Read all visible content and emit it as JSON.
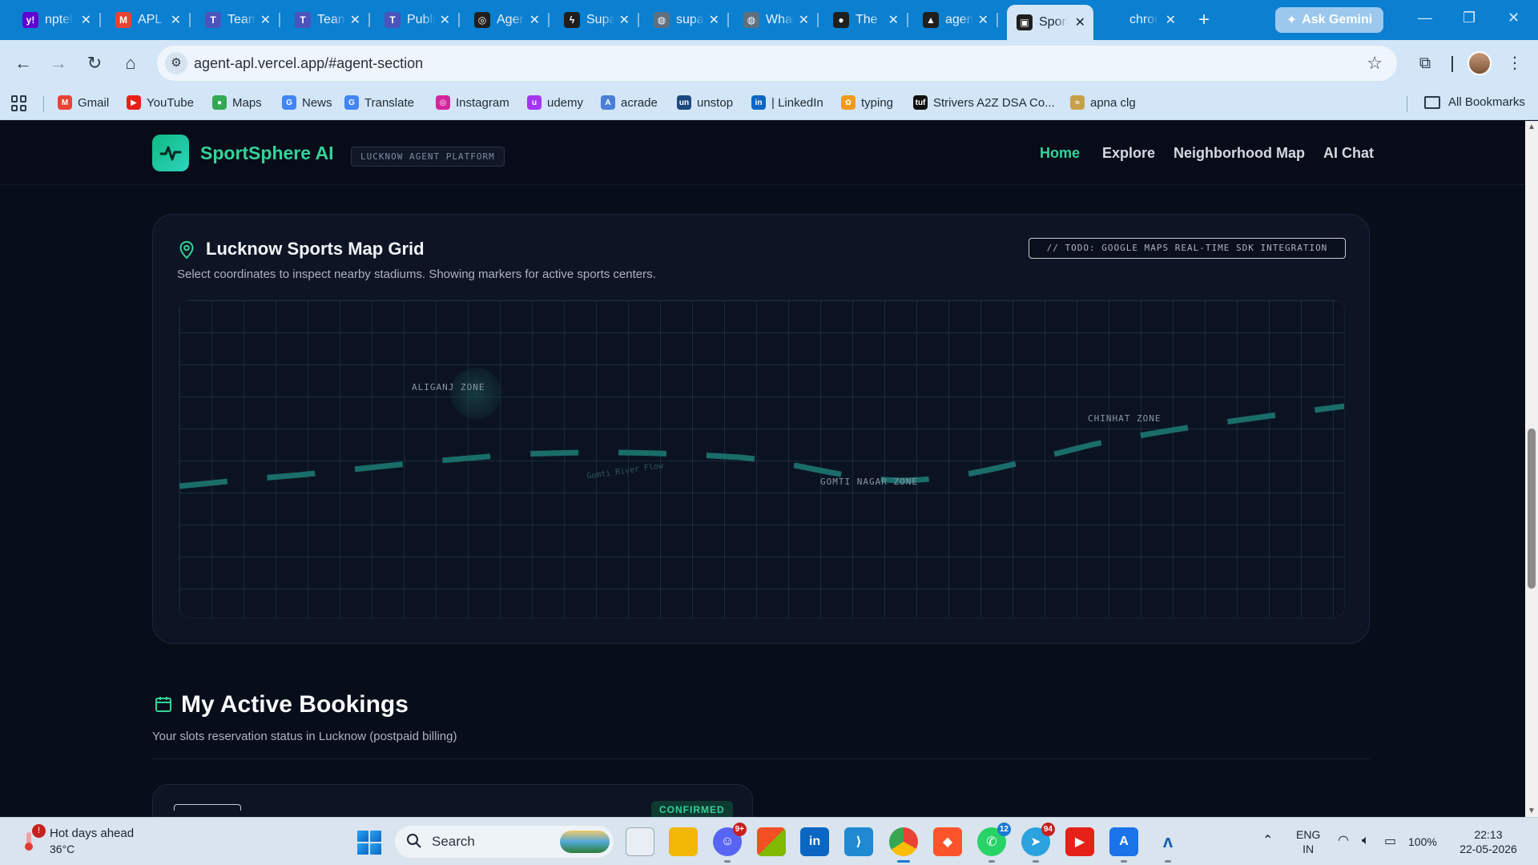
{
  "browser": {
    "tabs": [
      {
        "title": "nptel",
        "icon": "yahoo-icon",
        "color": "#6001d2",
        "glyph": "y!"
      },
      {
        "title": "APL",
        "icon": "gmail-icon",
        "color": "#ea4335",
        "glyph": "M"
      },
      {
        "title": "Teams",
        "icon": "teams-icon",
        "color": "#4b53bc",
        "glyph": "T"
      },
      {
        "title": "Teams",
        "icon": "teams-icon",
        "color": "#4b53bc",
        "glyph": "T"
      },
      {
        "title": "Public",
        "icon": "teams-icon",
        "color": "#4b53bc",
        "glyph": "T"
      },
      {
        "title": "Agent",
        "icon": "openai-icon",
        "color": "#1f1f1f",
        "glyph": "◎"
      },
      {
        "title": "Supabase",
        "icon": "supabase-icon",
        "color": "#1f1f1f",
        "glyph": "ϟ"
      },
      {
        "title": "supabase",
        "icon": "globe-icon",
        "color": "#5f6f80",
        "glyph": "◍"
      },
      {
        "title": "What",
        "icon": "globe-icon",
        "color": "#5f6f80",
        "glyph": "◍"
      },
      {
        "title": "The",
        "icon": "github-icon",
        "color": "#1f1f1f",
        "glyph": "●"
      },
      {
        "title": "agent",
        "icon": "vercel-icon",
        "color": "#1f1f1f",
        "glyph": "▲"
      },
      {
        "title": "SportSphere",
        "icon": "sportsphere-icon",
        "color": "#1f1f1f",
        "glyph": "▣",
        "active": true
      },
      {
        "title": "chrome",
        "icon": "",
        "color": "",
        "glyph": ""
      }
    ],
    "ask_gemini": "Ask Gemini",
    "url": "agent-apl.vercel.app/#agent-section"
  },
  "bookmarks": [
    {
      "label": "Gmail",
      "icon": "gmail-icon",
      "color": "#ea4335",
      "glyph": "M"
    },
    {
      "label": "YouTube",
      "icon": "youtube-icon",
      "color": "#e62117",
      "glyph": "▶"
    },
    {
      "label": "Maps",
      "icon": "maps-icon",
      "color": "#34a853",
      "glyph": "●"
    },
    {
      "label": "News",
      "icon": "news-icon",
      "color": "#4285f4",
      "glyph": "G"
    },
    {
      "label": "Translate",
      "icon": "translate-icon",
      "color": "#4285f4",
      "glyph": "G"
    },
    {
      "label": "Instagram",
      "icon": "instagram-icon",
      "color": "#d6249f",
      "glyph": "◎"
    },
    {
      "label": "udemy",
      "icon": "udemy-icon",
      "color": "#a435f0",
      "glyph": "u"
    },
    {
      "label": "acrade",
      "icon": "acrade-icon",
      "color": "#4a7fd6",
      "glyph": "A"
    },
    {
      "label": "unstop",
      "icon": "unstop-icon",
      "color": "#1c4980",
      "glyph": "un"
    },
    {
      "label": "| LinkedIn",
      "icon": "linkedin-icon",
      "color": "#0a66c2",
      "glyph": "in"
    },
    {
      "label": "typing",
      "icon": "typing-icon",
      "color": "#f29a1c",
      "glyph": "✿"
    },
    {
      "label": "Strivers A2Z DSA Co...",
      "icon": "tuf-icon",
      "color": "#111111",
      "glyph": "tuf"
    },
    {
      "label": "apna clg",
      "icon": "apnaclg-icon",
      "color": "#c8a04a",
      "glyph": "≈"
    }
  ],
  "all_bookmarks": "All Bookmarks",
  "site": {
    "brand": "SportSphere AI",
    "badge": "LUCKNOW AGENT PLATFORM",
    "nav": [
      "Home",
      "Explore",
      "Neighborhood Map",
      "AI Chat"
    ],
    "active_nav": "Home"
  },
  "map": {
    "title": "Lucknow Sports Map Grid",
    "subtitle": "Select coordinates to inspect nearby stadiums. Showing markers for active sports centers.",
    "todo": "// TODO: GOOGLE MAPS REAL-TIME SDK INTEGRATION",
    "zones": [
      "ALIGANJ ZONE",
      "CHINHAT ZONE",
      "GOMTI NAGAR ZONE"
    ],
    "river_label": "Gomti River Flow",
    "accent": "#34d399"
  },
  "bookings": {
    "title": "My Active Bookings",
    "subtitle": "Your slots reservation status in Lucknow (postpaid billing)",
    "status": "CONFIRMED"
  },
  "taskbar": {
    "weather_title": "Hot days ahead",
    "weather_temp": "36°C",
    "search": "Search",
    "lang1": "ENG",
    "lang2": "IN",
    "battery": "100%",
    "time": "22:13",
    "date": "22-05-2026",
    "badges": {
      "discord": "9+",
      "whatsapp": "12",
      "telegram": "94"
    }
  }
}
